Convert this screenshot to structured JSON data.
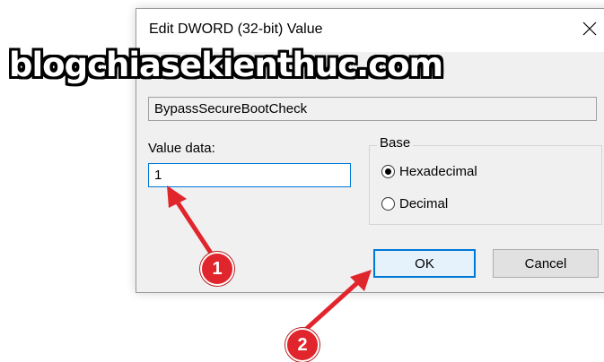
{
  "watermark": "blogchiasekienthuc.com",
  "dialog": {
    "title": "Edit DWORD (32-bit) Value",
    "close_glyph": "✕",
    "value_name": "BypassSecureBootCheck",
    "value_data_label": "Value data:",
    "value_data": "1",
    "base_group_label": "Base",
    "radios": [
      {
        "label": "Hexadecimal",
        "checked": true
      },
      {
        "label": "Decimal",
        "checked": false
      }
    ],
    "ok_label": "OK",
    "cancel_label": "Cancel"
  },
  "annotations": [
    {
      "number": "1"
    },
    {
      "number": "2"
    }
  ],
  "colors": {
    "arrow": "#e1252d",
    "focus_border": "#0078d7",
    "dialog_bg": "#f0f0f0"
  },
  "icons": [
    "close-icon",
    "radio-checked-icon",
    "radio-unchecked-icon",
    "arrow-annotation"
  ]
}
